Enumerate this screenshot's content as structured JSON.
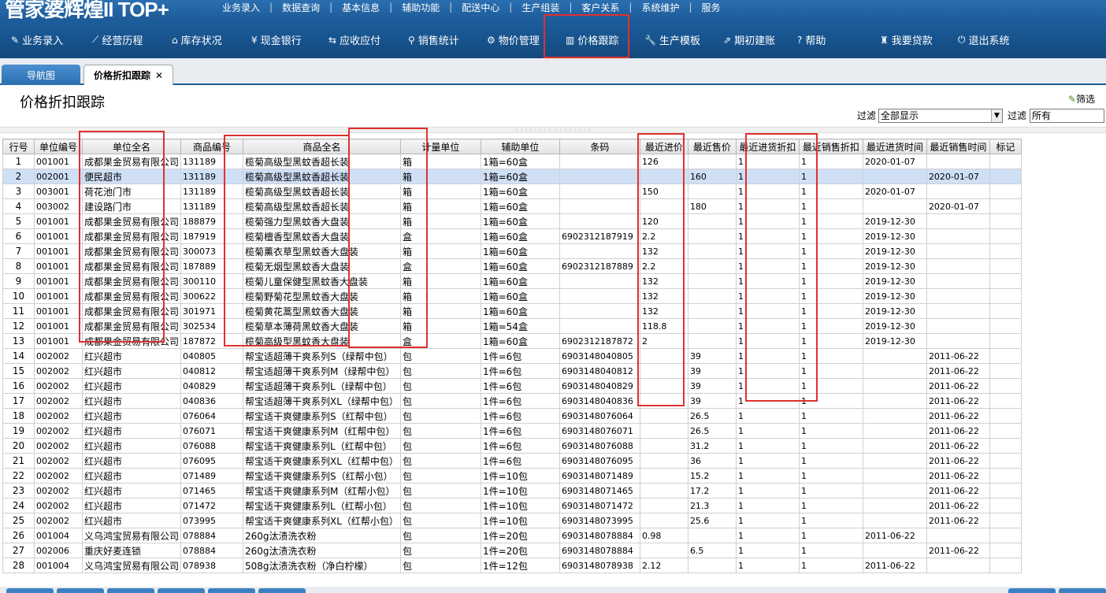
{
  "app": {
    "logo": "管家婆辉煌II TOP+"
  },
  "top_menu": [
    "业务录入",
    "数据查询",
    "基本信息",
    "辅助功能",
    "配送中心",
    "生产组装",
    "客户关系",
    "系统维护",
    "服务"
  ],
  "nav": [
    {
      "label": "业务录入",
      "icon": "edit-icon",
      "glyph": "✎"
    },
    {
      "label": "经营历程",
      "icon": "chart-icon",
      "glyph": "⟋"
    },
    {
      "label": "库存状况",
      "icon": "home-icon",
      "glyph": "⌂"
    },
    {
      "label": "现金银行",
      "icon": "yen-icon",
      "glyph": "¥"
    },
    {
      "label": "应收应付",
      "icon": "exchange-icon",
      "glyph": "⇆"
    },
    {
      "label": "销售统计",
      "icon": "search-icon",
      "glyph": "⚲"
    },
    {
      "label": "物价管理",
      "icon": "gear-icon",
      "glyph": "⚙"
    },
    {
      "label": "价格跟踪",
      "icon": "bar-chart-icon",
      "glyph": "▥"
    },
    {
      "label": "生产模板",
      "icon": "wrench-icon",
      "glyph": "🔧"
    },
    {
      "label": "期初建账",
      "icon": "external-icon",
      "glyph": "⇗"
    },
    {
      "label": "帮助",
      "icon": "help-icon",
      "glyph": "?"
    },
    {
      "label": "我要贷款",
      "icon": "money-bag-icon",
      "glyph": "♜"
    },
    {
      "label": "退出系统",
      "icon": "power-icon",
      "glyph": "⏻"
    }
  ],
  "tabs": [
    {
      "label": "导航图"
    },
    {
      "label": "价格折扣跟踪",
      "close": "✕"
    }
  ],
  "page": {
    "title": "价格折扣跟踪",
    "filter_button": "筛选",
    "filter1_label": "过滤",
    "filter1_value": "全部显示",
    "filter2_label": "过滤",
    "filter2_value": "所有"
  },
  "columns": [
    "行号",
    "单位编号",
    "单位全名",
    "商品编号",
    "商品全名",
    "计量单位",
    "辅助单位",
    "条码",
    "最近进价",
    "最近售价",
    "最近进货折扣",
    "最近销售折扣",
    "最近进货时间",
    "最近销售时间",
    "标记"
  ],
  "rows": [
    [
      "1",
      "001001",
      "成都果金贸易有限公司",
      "131189",
      "榄菊高级型黑蚊香超长装",
      "箱",
      "1箱=60盒",
      "",
      "126",
      "",
      "1",
      "1",
      "2020-01-07",
      "",
      ""
    ],
    [
      "2",
      "002001",
      "便民超市",
      "131189",
      "榄菊高级型黑蚊香超长装",
      "箱",
      "1箱=60盒",
      "",
      "",
      "160",
      "1",
      "1",
      "",
      "2020-01-07",
      ""
    ],
    [
      "3",
      "003001",
      "荷花池门市",
      "131189",
      "榄菊高级型黑蚊香超长装",
      "箱",
      "1箱=60盒",
      "",
      "150",
      "",
      "1",
      "1",
      "2020-01-07",
      "",
      ""
    ],
    [
      "4",
      "003002",
      "建设路门市",
      "131189",
      "榄菊高级型黑蚊香超长装",
      "箱",
      "1箱=60盒",
      "",
      "",
      "180",
      "1",
      "1",
      "",
      "2020-01-07",
      ""
    ],
    [
      "5",
      "001001",
      "成都果金贸易有限公司",
      "188879",
      "榄菊强力型黑蚊香大盘装",
      "箱",
      "1箱=60盒",
      "",
      "120",
      "",
      "1",
      "1",
      "2019-12-30",
      "",
      ""
    ],
    [
      "6",
      "001001",
      "成都果金贸易有限公司",
      "187919",
      "榄菊檀香型黑蚊香大盘装",
      "盒",
      "1箱=60盒",
      "6902312187919",
      "2.2",
      "",
      "1",
      "1",
      "2019-12-30",
      "",
      ""
    ],
    [
      "7",
      "001001",
      "成都果金贸易有限公司",
      "300073",
      "榄菊薰衣草型黑蚊香大盘装",
      "箱",
      "1箱=60盒",
      "",
      "132",
      "",
      "1",
      "1",
      "2019-12-30",
      "",
      ""
    ],
    [
      "8",
      "001001",
      "成都果金贸易有限公司",
      "187889",
      "榄菊无烟型黑蚊香大盘装",
      "盒",
      "1箱=60盒",
      "6902312187889",
      "2.2",
      "",
      "1",
      "1",
      "2019-12-30",
      "",
      ""
    ],
    [
      "9",
      "001001",
      "成都果金贸易有限公司",
      "300110",
      "榄菊儿童保健型黑蚊香大盘装",
      "箱",
      "1箱=60盒",
      "",
      "132",
      "",
      "1",
      "1",
      "2019-12-30",
      "",
      ""
    ],
    [
      "10",
      "001001",
      "成都果金贸易有限公司",
      "300622",
      "榄菊野菊花型黑蚊香大盘装",
      "箱",
      "1箱=60盒",
      "",
      "132",
      "",
      "1",
      "1",
      "2019-12-30",
      "",
      ""
    ],
    [
      "11",
      "001001",
      "成都果金贸易有限公司",
      "301971",
      "榄菊黄花蒿型黑蚊香大盘装",
      "箱",
      "1箱=60盒",
      "",
      "132",
      "",
      "1",
      "1",
      "2019-12-30",
      "",
      ""
    ],
    [
      "12",
      "001001",
      "成都果金贸易有限公司",
      "302534",
      "榄菊草本薄荷黑蚊香大盘装",
      "箱",
      "1箱=54盒",
      "",
      "118.8",
      "",
      "1",
      "1",
      "2019-12-30",
      "",
      ""
    ],
    [
      "13",
      "001001",
      "成都果金贸易有限公司",
      "187872",
      "榄菊高级型黑蚊香大盘装",
      "盒",
      "1箱=60盒",
      "6902312187872",
      "2",
      "",
      "1",
      "1",
      "2019-12-30",
      "",
      ""
    ],
    [
      "14",
      "002002",
      "红兴超市",
      "040805",
      "帮宝适超薄干爽系列S（绿帮中包）",
      "包",
      "1件=6包",
      "6903148040805",
      "",
      "39",
      "1",
      "1",
      "",
      "2011-06-22",
      ""
    ],
    [
      "15",
      "002002",
      "红兴超市",
      "040812",
      "帮宝适超薄干爽系列M（绿帮中包）",
      "包",
      "1件=6包",
      "6903148040812",
      "",
      "39",
      "1",
      "1",
      "",
      "2011-06-22",
      ""
    ],
    [
      "16",
      "002002",
      "红兴超市",
      "040829",
      "帮宝适超薄干爽系列L（绿帮中包）",
      "包",
      "1件=6包",
      "6903148040829",
      "",
      "39",
      "1",
      "1",
      "",
      "2011-06-22",
      ""
    ],
    [
      "17",
      "002002",
      "红兴超市",
      "040836",
      "帮宝适超薄干爽系列XL（绿帮中包）",
      "包",
      "1件=6包",
      "6903148040836",
      "",
      "39",
      "1",
      "1",
      "",
      "2011-06-22",
      ""
    ],
    [
      "18",
      "002002",
      "红兴超市",
      "076064",
      "帮宝适干爽健康系列S（红帮中包）",
      "包",
      "1件=6包",
      "6903148076064",
      "",
      "26.5",
      "1",
      "1",
      "",
      "2011-06-22",
      ""
    ],
    [
      "19",
      "002002",
      "红兴超市",
      "076071",
      "帮宝适干爽健康系列M（红帮中包）",
      "包",
      "1件=6包",
      "6903148076071",
      "",
      "26.5",
      "1",
      "1",
      "",
      "2011-06-22",
      ""
    ],
    [
      "20",
      "002002",
      "红兴超市",
      "076088",
      "帮宝适干爽健康系列L（红帮中包）",
      "包",
      "1件=6包",
      "6903148076088",
      "",
      "31.2",
      "1",
      "1",
      "",
      "2011-06-22",
      ""
    ],
    [
      "21",
      "002002",
      "红兴超市",
      "076095",
      "帮宝适干爽健康系列XL（红帮中包）",
      "包",
      "1件=6包",
      "6903148076095",
      "",
      "36",
      "1",
      "1",
      "",
      "2011-06-22",
      ""
    ],
    [
      "22",
      "002002",
      "红兴超市",
      "071489",
      "帮宝适干爽健康系列S（红帮小包）",
      "包",
      "1件=10包",
      "6903148071489",
      "",
      "15.2",
      "1",
      "1",
      "",
      "2011-06-22",
      ""
    ],
    [
      "23",
      "002002",
      "红兴超市",
      "071465",
      "帮宝适干爽健康系列M（红帮小包）",
      "包",
      "1件=10包",
      "6903148071465",
      "",
      "17.2",
      "1",
      "1",
      "",
      "2011-06-22",
      ""
    ],
    [
      "24",
      "002002",
      "红兴超市",
      "071472",
      "帮宝适干爽健康系列L（红帮小包）",
      "包",
      "1件=10包",
      "6903148071472",
      "",
      "21.3",
      "1",
      "1",
      "",
      "2011-06-22",
      ""
    ],
    [
      "25",
      "002002",
      "红兴超市",
      "073995",
      "帮宝适干爽健康系列XL（红帮小包）",
      "包",
      "1件=10包",
      "6903148073995",
      "",
      "25.6",
      "1",
      "1",
      "",
      "2011-06-22",
      ""
    ],
    [
      "26",
      "001004",
      "义乌鸿宝贸易有限公司",
      "078884",
      "260g汰渍洗衣粉",
      "包",
      "1件=20包",
      "6903148078884",
      "0.98",
      "",
      "1",
      "1",
      "2011-06-22",
      "",
      ""
    ],
    [
      "27",
      "002006",
      "重庆好麦连锁",
      "078884",
      "260g汰渍洗衣粉",
      "包",
      "1件=20包",
      "6903148078884",
      "",
      "6.5",
      "1",
      "1",
      "",
      "2011-06-22",
      ""
    ],
    [
      "28",
      "001004",
      "义乌鸿宝贸易有限公司",
      "078938",
      "508g汰渍洗衣粉（净白柠檬）",
      "包",
      "1件=12包",
      "6903148078938",
      "2.12",
      "",
      "1",
      "1",
      "2011-06-22",
      "",
      ""
    ]
  ],
  "selected_row": 1,
  "colors": {
    "highlight": "#e03030",
    "nav_bg": "#1b5d9c",
    "selected_row": "#cfe0f6"
  }
}
